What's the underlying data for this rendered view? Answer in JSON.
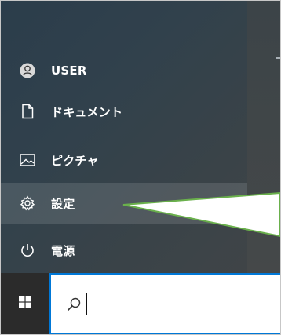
{
  "start_menu": {
    "items": [
      {
        "label": "USER",
        "icon": "user-icon"
      },
      {
        "label": "ドキュメント",
        "icon": "document-icon"
      },
      {
        "label": "ピクチャ",
        "icon": "pictures-icon"
      },
      {
        "label": "設定",
        "icon": "gear-icon"
      },
      {
        "label": "電源",
        "icon": "power-icon"
      }
    ]
  },
  "taskbar": {
    "start_icon": "windows-logo-icon",
    "search_icon": "search-icon",
    "search_value": ""
  },
  "colors": {
    "accent": "#0078d7",
    "callout_stroke": "#6ab04c",
    "callout_fill": "#ffffff"
  }
}
